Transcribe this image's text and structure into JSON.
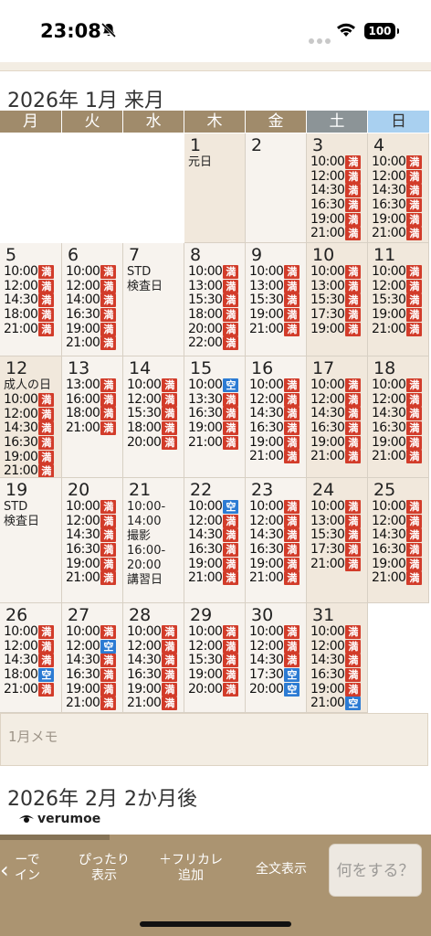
{
  "status": {
    "time": "23:08",
    "battery": "100"
  },
  "month": {
    "title": "2026年 1月 来月"
  },
  "weekdays": [
    "月",
    "火",
    "水",
    "木",
    "金",
    "土",
    "日"
  ],
  "days": [
    {
      "d": "1",
      "notes": [
        "元日"
      ],
      "slots": []
    },
    {
      "d": "2",
      "notes": [],
      "slots": []
    },
    {
      "d": "3",
      "notes": [],
      "slots": [
        {
          "t": "10:00",
          "s": "満"
        },
        {
          "t": "12:00",
          "s": "満"
        },
        {
          "t": "14:30",
          "s": "満"
        },
        {
          "t": "16:30",
          "s": "満"
        },
        {
          "t": "19:00",
          "s": "満"
        },
        {
          "t": "21:00",
          "s": "満"
        }
      ]
    },
    {
      "d": "4",
      "notes": [],
      "slots": [
        {
          "t": "10:00",
          "s": "満"
        },
        {
          "t": "12:00",
          "s": "満"
        },
        {
          "t": "14:30",
          "s": "満"
        },
        {
          "t": "16:30",
          "s": "満"
        },
        {
          "t": "19:00",
          "s": "満"
        },
        {
          "t": "21:00",
          "s": "満"
        }
      ]
    },
    {
      "d": "5",
      "notes": [],
      "slots": [
        {
          "t": "10:00",
          "s": "満"
        },
        {
          "t": "12:00",
          "s": "満"
        },
        {
          "t": "14:30",
          "s": "満"
        },
        {
          "t": "18:00",
          "s": "満"
        },
        {
          "t": "21:00",
          "s": "満"
        }
      ]
    },
    {
      "d": "6",
      "notes": [],
      "slots": [
        {
          "t": "10:00",
          "s": "満"
        },
        {
          "t": "12:00",
          "s": "満"
        },
        {
          "t": "14:00",
          "s": "満"
        },
        {
          "t": "16:30",
          "s": "満"
        },
        {
          "t": "19:00",
          "s": "満"
        },
        {
          "t": "21:00",
          "s": "満"
        }
      ]
    },
    {
      "d": "7",
      "notes": [
        "STD",
        "検査日"
      ],
      "slots": []
    },
    {
      "d": "8",
      "notes": [],
      "slots": [
        {
          "t": "10:00",
          "s": "満"
        },
        {
          "t": "13:00",
          "s": "満"
        },
        {
          "t": "15:30",
          "s": "満"
        },
        {
          "t": "18:00",
          "s": "満"
        },
        {
          "t": "20:00",
          "s": "満"
        },
        {
          "t": "22:00",
          "s": "満"
        }
      ]
    },
    {
      "d": "9",
      "notes": [],
      "slots": [
        {
          "t": "10:00",
          "s": "満"
        },
        {
          "t": "13:00",
          "s": "満"
        },
        {
          "t": "15:30",
          "s": "満"
        },
        {
          "t": "19:00",
          "s": "満"
        },
        {
          "t": "21:00",
          "s": "満"
        }
      ]
    },
    {
      "d": "10",
      "notes": [],
      "slots": [
        {
          "t": "10:00",
          "s": "満"
        },
        {
          "t": "13:00",
          "s": "満"
        },
        {
          "t": "15:30",
          "s": "満"
        },
        {
          "t": "17:30",
          "s": "満"
        },
        {
          "t": "19:00",
          "s": "満"
        }
      ]
    },
    {
      "d": "11",
      "notes": [],
      "slots": [
        {
          "t": "10:00",
          "s": "満"
        },
        {
          "t": "12:00",
          "s": "満"
        },
        {
          "t": "15:30",
          "s": "満"
        },
        {
          "t": "19:00",
          "s": "満"
        },
        {
          "t": "21:00",
          "s": "満"
        }
      ]
    },
    {
      "d": "12",
      "notes": [
        "成人の日"
      ],
      "slots": [
        {
          "t": "10:00",
          "s": "満"
        },
        {
          "t": "12:00",
          "s": "満"
        },
        {
          "t": "14:30",
          "s": "満"
        },
        {
          "t": "16:30",
          "s": "満"
        },
        {
          "t": "19:00",
          "s": "満"
        },
        {
          "t": "21:00",
          "s": "満"
        }
      ]
    },
    {
      "d": "13",
      "notes": [],
      "slots": [
        {
          "t": "13:00",
          "s": "満"
        },
        {
          "t": "16:00",
          "s": "満"
        },
        {
          "t": "18:00",
          "s": "満"
        },
        {
          "t": "21:00",
          "s": "満"
        }
      ]
    },
    {
      "d": "14",
      "notes": [],
      "slots": [
        {
          "t": "10:00",
          "s": "満"
        },
        {
          "t": "12:00",
          "s": "満"
        },
        {
          "t": "15:30",
          "s": "満"
        },
        {
          "t": "18:00",
          "s": "満"
        },
        {
          "t": "20:00",
          "s": "満"
        }
      ]
    },
    {
      "d": "15",
      "notes": [],
      "slots": [
        {
          "t": "10:00",
          "s": "空"
        },
        {
          "t": "13:30",
          "s": "満"
        },
        {
          "t": "16:30",
          "s": "満"
        },
        {
          "t": "19:00",
          "s": "満"
        },
        {
          "t": "21:00",
          "s": "満"
        }
      ]
    },
    {
      "d": "16",
      "notes": [],
      "slots": [
        {
          "t": "10:00",
          "s": "満"
        },
        {
          "t": "12:00",
          "s": "満"
        },
        {
          "t": "14:30",
          "s": "満"
        },
        {
          "t": "16:30",
          "s": "満"
        },
        {
          "t": "19:00",
          "s": "満"
        },
        {
          "t": "21:00",
          "s": "満"
        }
      ]
    },
    {
      "d": "17",
      "notes": [],
      "slots": [
        {
          "t": "10:00",
          "s": "満"
        },
        {
          "t": "12:00",
          "s": "満"
        },
        {
          "t": "14:30",
          "s": "満"
        },
        {
          "t": "16:30",
          "s": "満"
        },
        {
          "t": "19:00",
          "s": "満"
        },
        {
          "t": "21:00",
          "s": "満"
        }
      ]
    },
    {
      "d": "18",
      "notes": [],
      "slots": [
        {
          "t": "10:00",
          "s": "満"
        },
        {
          "t": "12:00",
          "s": "満"
        },
        {
          "t": "14:30",
          "s": "満"
        },
        {
          "t": "16:30",
          "s": "満"
        },
        {
          "t": "19:00",
          "s": "満"
        },
        {
          "t": "21:00",
          "s": "満"
        }
      ]
    },
    {
      "d": "19",
      "notes": [
        "STD",
        "検査日"
      ],
      "slots": []
    },
    {
      "d": "20",
      "notes": [],
      "slots": [
        {
          "t": "10:00",
          "s": "満"
        },
        {
          "t": "12:00",
          "s": "満"
        },
        {
          "t": "14:30",
          "s": "満"
        },
        {
          "t": "16:30",
          "s": "満"
        },
        {
          "t": "19:00",
          "s": "満"
        },
        {
          "t": "21:00",
          "s": "満"
        }
      ]
    },
    {
      "d": "21",
      "notes": [
        "10:00-",
        "14:00",
        "撮影",
        "16:00-",
        "20:00",
        "講習日"
      ],
      "slots": []
    },
    {
      "d": "22",
      "notes": [],
      "slots": [
        {
          "t": "10:00",
          "s": "空"
        },
        {
          "t": "12:00",
          "s": "満"
        },
        {
          "t": "14:30",
          "s": "満"
        },
        {
          "t": "16:30",
          "s": "満"
        },
        {
          "t": "19:00",
          "s": "満"
        },
        {
          "t": "21:00",
          "s": "満"
        }
      ]
    },
    {
      "d": "23",
      "notes": [],
      "slots": [
        {
          "t": "10:00",
          "s": "満"
        },
        {
          "t": "12:00",
          "s": "満"
        },
        {
          "t": "14:30",
          "s": "満"
        },
        {
          "t": "16:30",
          "s": "満"
        },
        {
          "t": "19:00",
          "s": "満"
        },
        {
          "t": "21:00",
          "s": "満"
        }
      ]
    },
    {
      "d": "24",
      "notes": [],
      "slots": [
        {
          "t": "10:00",
          "s": "満"
        },
        {
          "t": "13:00",
          "s": "満"
        },
        {
          "t": "15:30",
          "s": "満"
        },
        {
          "t": "17:30",
          "s": "満"
        },
        {
          "t": "21:00",
          "s": "満"
        }
      ]
    },
    {
      "d": "25",
      "notes": [],
      "slots": [
        {
          "t": "10:00",
          "s": "満"
        },
        {
          "t": "12:00",
          "s": "満"
        },
        {
          "t": "14:30",
          "s": "満"
        },
        {
          "t": "16:30",
          "s": "満"
        },
        {
          "t": "19:00",
          "s": "満"
        },
        {
          "t": "21:00",
          "s": "満"
        }
      ]
    },
    {
      "d": "26",
      "notes": [],
      "slots": [
        {
          "t": "10:00",
          "s": "満"
        },
        {
          "t": "12:00",
          "s": "満"
        },
        {
          "t": "14:30",
          "s": "満"
        },
        {
          "t": "18:00",
          "s": "空"
        },
        {
          "t": "21:00",
          "s": "満"
        }
      ]
    },
    {
      "d": "27",
      "notes": [],
      "slots": [
        {
          "t": "10:00",
          "s": "満"
        },
        {
          "t": "12:00",
          "s": "空"
        },
        {
          "t": "14:30",
          "s": "満"
        },
        {
          "t": "16:30",
          "s": "満"
        },
        {
          "t": "19:00",
          "s": "満"
        },
        {
          "t": "21:00",
          "s": "満"
        }
      ]
    },
    {
      "d": "28",
      "notes": [],
      "slots": [
        {
          "t": "10:00",
          "s": "満"
        },
        {
          "t": "12:00",
          "s": "満"
        },
        {
          "t": "14:30",
          "s": "満"
        },
        {
          "t": "16:30",
          "s": "満"
        },
        {
          "t": "19:00",
          "s": "満"
        },
        {
          "t": "21:00",
          "s": "満"
        }
      ]
    },
    {
      "d": "29",
      "notes": [],
      "slots": [
        {
          "t": "10:00",
          "s": "満"
        },
        {
          "t": "12:00",
          "s": "満"
        },
        {
          "t": "15:30",
          "s": "満"
        },
        {
          "t": "19:00",
          "s": "満"
        },
        {
          "t": "20:00",
          "s": "満"
        }
      ]
    },
    {
      "d": "30",
      "notes": [],
      "slots": [
        {
          "t": "10:00",
          "s": "満"
        },
        {
          "t": "12:00",
          "s": "満"
        },
        {
          "t": "14:30",
          "s": "満"
        },
        {
          "t": "17:30",
          "s": "空"
        },
        {
          "t": "20:00",
          "s": "空"
        }
      ]
    },
    {
      "d": "31",
      "notes": [],
      "slots": [
        {
          "t": "10:00",
          "s": "満"
        },
        {
          "t": "12:00",
          "s": "満"
        },
        {
          "t": "14:30",
          "s": "満"
        },
        {
          "t": "16:30",
          "s": "満"
        },
        {
          "t": "19:00",
          "s": "満"
        },
        {
          "t": "21:00",
          "s": "空"
        }
      ]
    }
  ],
  "memo": {
    "placeholder": "1月メモ"
  },
  "next_month": {
    "title": "2026年 2月 2か月後"
  },
  "brand": {
    "logo_text": "verumoe"
  },
  "toolbar": {
    "btn1": [
      "ーで",
      "イン"
    ],
    "btn2": [
      "ぴったり",
      "表示"
    ],
    "btn3": [
      "＋フリカレ",
      "追加"
    ],
    "btn4": "全文表示",
    "do_label": "何をする？"
  },
  "colors": {
    "full": "#d23c2a",
    "vacant": "#2c7bd3",
    "header": "#a08b6b",
    "sat": "#8c9497",
    "sun": "#a9d0f0",
    "toolbar": "#ab9471"
  },
  "icons": {
    "bell": "bell-slash-icon",
    "wifi": "wifi-icon",
    "battery": "battery-icon",
    "chevron": "chevron-left-icon",
    "logo": "eye-logo-icon"
  }
}
